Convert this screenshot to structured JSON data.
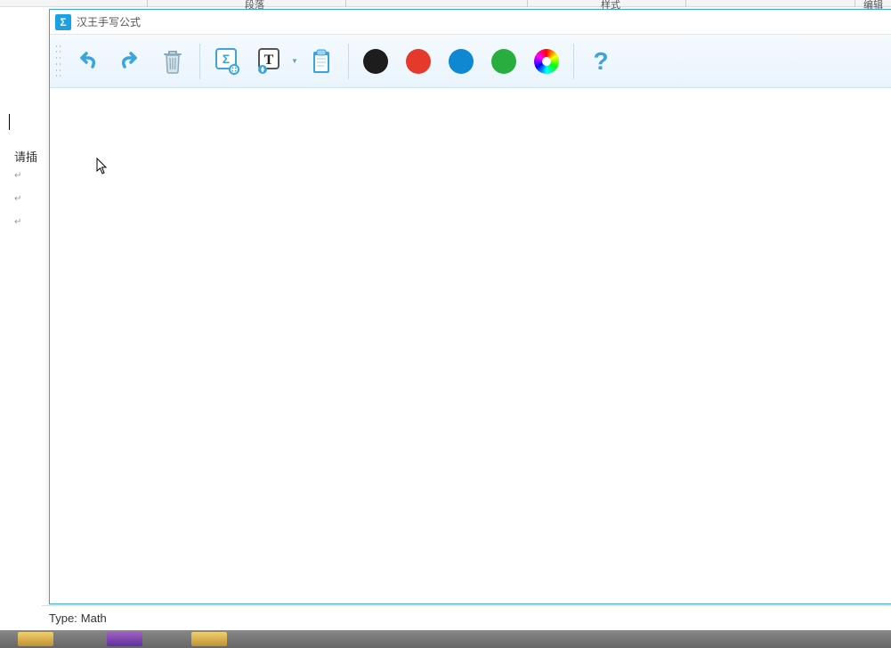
{
  "background": {
    "ribbon_label_1": "段落",
    "ribbon_label_2": "样式",
    "ribbon_label_3": "编辑",
    "side_text": "请插",
    "para_marks": [
      "↵",
      "↵",
      "↵"
    ]
  },
  "window": {
    "title": "汉王手写公式",
    "app_icon_glyph": "Σ"
  },
  "toolbar": {
    "undo": "undo",
    "redo": "redo",
    "delete": "delete",
    "formula_settings": "formula-settings",
    "text_mode": "text-mode",
    "clipboard": "clipboard",
    "colors": {
      "black": "#1d1d1d",
      "red": "#e53a2b",
      "blue": "#0e88d3",
      "green": "#27ae3f"
    },
    "help_glyph": "?"
  },
  "status": {
    "type_label": "Type:",
    "type_value": "Math"
  }
}
